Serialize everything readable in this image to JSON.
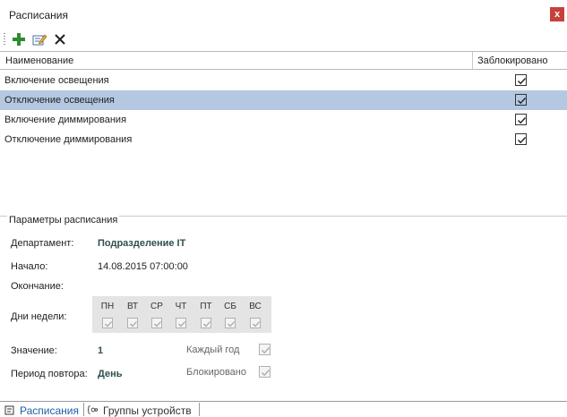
{
  "window": {
    "title": "Расписания",
    "close_label": "x"
  },
  "toolbar": {
    "add_icon": "plus-icon",
    "edit_icon": "edit-icon",
    "delete_icon": "close-icon",
    "add_color": "#2e8b2e",
    "delete_color": "#222222"
  },
  "grid": {
    "columns": {
      "name": "Наименование",
      "locked": "Заблокировано"
    },
    "rows": [
      {
        "name": "Включение освещения",
        "locked": true,
        "selected": false
      },
      {
        "name": "Отключение освещения",
        "locked": true,
        "selected": true
      },
      {
        "name": "Включение диммирования",
        "locked": true,
        "selected": false
      },
      {
        "name": "Отключение диммирования",
        "locked": true,
        "selected": false
      }
    ],
    "selected_color": "#b4c8e2"
  },
  "params": {
    "legend": "Параметры расписания",
    "department_label": "Департамент:",
    "department_value": "Подразделение IT",
    "start_label": "Начало:",
    "start_value": "14.08.2015 07:00:00",
    "end_label": "Окончание:",
    "days_label": "Дни недели:",
    "days": [
      {
        "name": "ПН",
        "checked": true
      },
      {
        "name": "ВТ",
        "checked": true
      },
      {
        "name": "СР",
        "checked": true
      },
      {
        "name": "ЧТ",
        "checked": true
      },
      {
        "name": "ПТ",
        "checked": true
      },
      {
        "name": "СБ",
        "checked": true
      },
      {
        "name": "ВС",
        "checked": true
      }
    ],
    "value_label": "Значение:",
    "value": "1",
    "every_year_label": "Каждый год",
    "every_year_checked": true,
    "period_label": "Период повтора:",
    "period_value": "День",
    "blocked_label": "Блокировано",
    "blocked_checked": true
  },
  "tabs": [
    {
      "label": "Расписания",
      "active": true,
      "icon": "schedule-icon"
    },
    {
      "label": "Группы устройств",
      "active": false,
      "icon": "device-group-icon"
    }
  ]
}
